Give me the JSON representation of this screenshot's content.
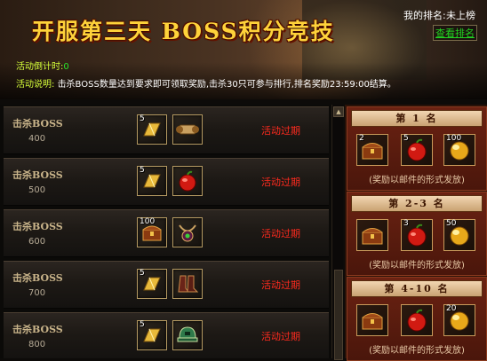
{
  "header": {
    "title": "开服第三天 BOSS积分竞技",
    "rank_label": "我的排名:",
    "rank_value": "未上榜",
    "rank_link": "查看排名",
    "countdown_label": "活动倒计时:",
    "countdown_value": "0",
    "desc_label": "活动说明:",
    "desc_text": "击杀BOSS数量达到要求即可领取奖励,击杀30只可参与排行,排名奖励23:59:00结算。"
  },
  "rows": [
    {
      "name": "击杀BOSS",
      "score": "400",
      "status": "活动过期",
      "items": [
        {
          "count": "5",
          "icon": "gold-bar-icon"
        },
        {
          "count": "",
          "icon": "scroll-icon"
        }
      ]
    },
    {
      "name": "击杀BOSS",
      "score": "500",
      "status": "活动过期",
      "items": [
        {
          "count": "5",
          "icon": "gold-bar-icon"
        },
        {
          "count": "",
          "icon": "red-apple-icon"
        }
      ]
    },
    {
      "name": "击杀BOSS",
      "score": "600",
      "status": "活动过期",
      "items": [
        {
          "count": "100",
          "icon": "treasure-chest-icon"
        },
        {
          "count": "",
          "icon": "amulet-icon"
        }
      ]
    },
    {
      "name": "击杀BOSS",
      "score": "700",
      "status": "活动过期",
      "items": [
        {
          "count": "5",
          "icon": "gold-bar-icon"
        },
        {
          "count": "",
          "icon": "boots-icon"
        }
      ]
    },
    {
      "name": "击杀BOSS",
      "score": "800",
      "status": "活动过期",
      "items": [
        {
          "count": "5",
          "icon": "gold-bar-icon"
        },
        {
          "count": "",
          "icon": "helmet-icon"
        }
      ]
    }
  ],
  "ranks": [
    {
      "title": "第 1 名",
      "items": [
        {
          "count": "2",
          "icon": "treasure-chest-icon"
        },
        {
          "count": "5",
          "icon": "red-apple-icon"
        },
        {
          "count": "100",
          "icon": "gold-orb-icon"
        }
      ],
      "note": "(奖励以邮件的形式发放)"
    },
    {
      "title": "第 2-3 名",
      "items": [
        {
          "count": "",
          "icon": "treasure-chest-icon"
        },
        {
          "count": "3",
          "icon": "red-apple-icon"
        },
        {
          "count": "50",
          "icon": "gold-orb-icon"
        }
      ],
      "note": "(奖励以邮件的形式发放)"
    },
    {
      "title": "第 4-10 名",
      "items": [
        {
          "count": "",
          "icon": "treasure-chest-icon"
        },
        {
          "count": "",
          "icon": "red-apple-icon"
        },
        {
          "count": "20",
          "icon": "gold-orb-icon"
        }
      ],
      "note": "(奖励以邮件的形式发放)"
    }
  ],
  "colors": {
    "accent": "#ffd23a",
    "expired": "#ff2a1e",
    "link": "#21d321"
  }
}
